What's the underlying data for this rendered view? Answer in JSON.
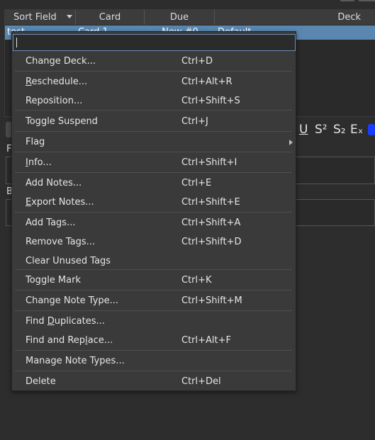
{
  "table": {
    "columns": [
      "Sort Field",
      "Card",
      "Due",
      "Deck"
    ],
    "rows": [
      [
        "test",
        "Card 1",
        "New #0",
        "Default"
      ]
    ]
  },
  "editor": {
    "formatting": [
      "U",
      "S²",
      "S₂",
      "Eₓ"
    ],
    "field_labels": [
      "F",
      "B"
    ]
  },
  "menu": {
    "search_value": "",
    "items": [
      {
        "label": "Change Deck...",
        "shortcut": "Ctrl+D",
        "underline": ""
      },
      {
        "label": "Reschedule...",
        "shortcut": "Ctrl+Alt+R",
        "underline": "R"
      },
      {
        "label": "Reposition...",
        "shortcut": "Ctrl+Shift+S",
        "underline": ""
      },
      {
        "label": "Toggle Suspend",
        "shortcut": "Ctrl+J",
        "underline": ""
      },
      {
        "label": "Flag",
        "shortcut": "",
        "underline": "",
        "submenu": true
      },
      {
        "label": "Info...",
        "shortcut": "Ctrl+Shift+I",
        "underline": "I"
      },
      {
        "label": "Add Notes...",
        "shortcut": "Ctrl+E",
        "underline": ""
      },
      {
        "label": "Export Notes...",
        "shortcut": "Ctrl+Shift+E",
        "underline": "E"
      },
      {
        "label": "Add Tags...",
        "shortcut": "Ctrl+Shift+A",
        "underline": ""
      },
      {
        "label": "Remove Tags...",
        "shortcut": "Ctrl+Shift+D",
        "underline": ""
      },
      {
        "label": "Clear Unused Tags",
        "shortcut": "",
        "underline": ""
      },
      {
        "label": "Toggle Mark",
        "shortcut": "Ctrl+K",
        "underline": ""
      },
      {
        "label": "Change Note Type...",
        "shortcut": "Ctrl+Shift+M",
        "underline": ""
      },
      {
        "label": "Find Duplicates...",
        "shortcut": "",
        "underline": "D"
      },
      {
        "label": "Find and Replace...",
        "shortcut": "Ctrl+Alt+F",
        "underline": "l"
      },
      {
        "label": "Manage Note Types...",
        "shortcut": "",
        "underline": ""
      },
      {
        "label": "Delete",
        "shortcut": "Ctrl+Del",
        "underline": ""
      }
    ]
  },
  "colors": {
    "selection": "#5a87b0",
    "menu_bg": "#3a3a3a",
    "background": "#2d2d2d",
    "color_button": "#1a3cff"
  }
}
